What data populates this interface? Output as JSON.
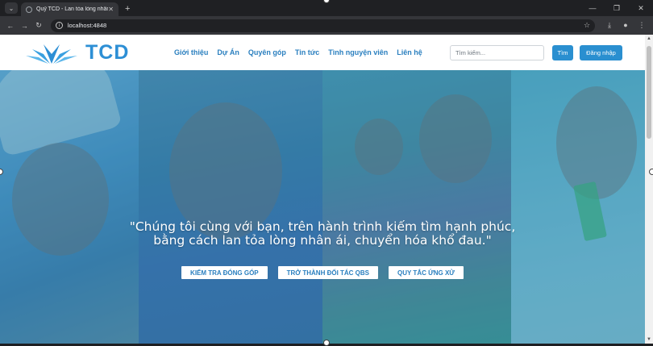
{
  "browser": {
    "tab_title": "Quỹ TCD - Lan tỏa lòng nhân ái",
    "tab_close": "✕",
    "new_tab": "+",
    "url": "localhost:4848"
  },
  "header": {
    "logo_text": "TCD",
    "nav": [
      "Giới thiệu",
      "Dự Án",
      "Quyên góp",
      "Tin tức",
      "Tình nguyện viên",
      "Liên hệ"
    ],
    "search_placeholder": "Tìm kiếm...",
    "search_button": "Tìm",
    "login_button": "Đăng nhập"
  },
  "hero": {
    "quote_line1": "\"Chúng tôi cùng với bạn, trên hành trình kiếm tìm hạnh phúc,",
    "quote_line2": "bằng cách lan tỏa lòng nhân ái, chuyển hóa khổ đau.\"",
    "buttons": [
      "KIỂM TRA ĐÓNG GÓP",
      "TRỞ THÀNH ĐỐI TÁC QBS",
      "QUY TẮC ỨNG XỬ"
    ]
  },
  "colors": {
    "brand": "#2d8fd5",
    "nav_link": "#2a7fbf",
    "button": "#2a8fd0"
  }
}
